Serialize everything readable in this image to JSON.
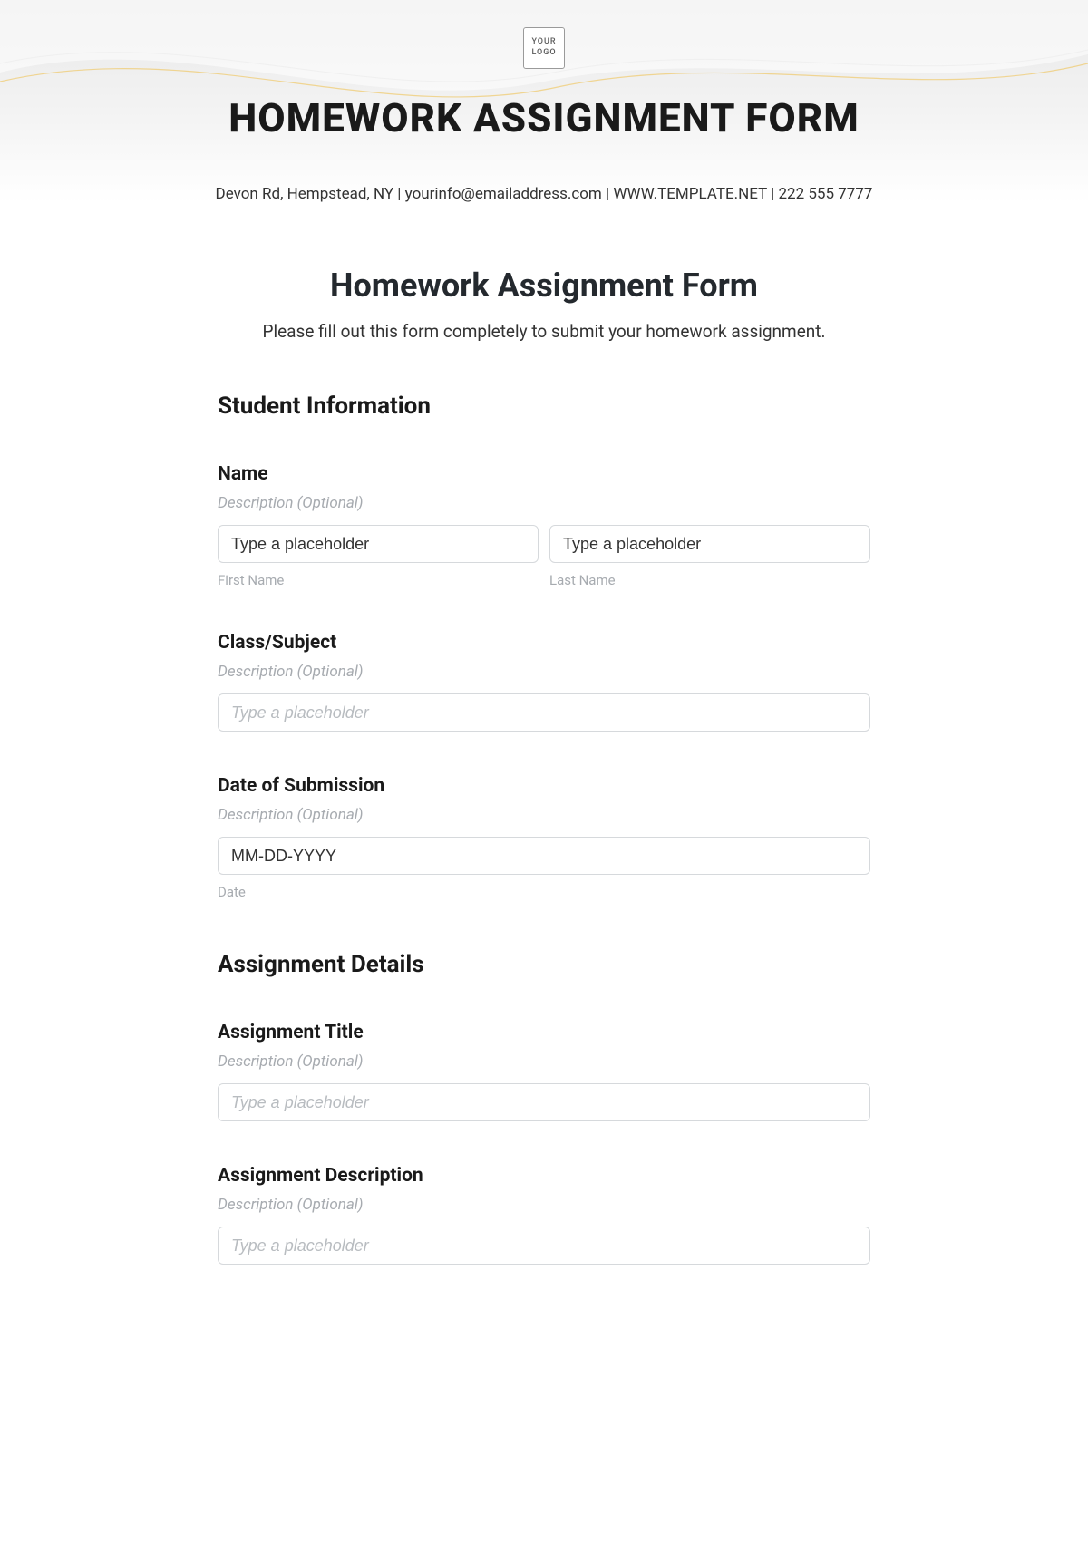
{
  "banner": {
    "logo_text": "YOUR LOGO",
    "title": "HOMEWORK ASSIGNMENT FORM",
    "contact": "Devon Rd, Hempstead, NY | yourinfo@emailaddress.com | WWW.TEMPLATE.NET | 222 555 7777"
  },
  "form": {
    "title": "Homework Assignment Form",
    "subtitle": "Please fill out this form completely to submit your homework assignment."
  },
  "sections": {
    "student_info": "Student Information",
    "assignment_details": "Assignment Details"
  },
  "fields": {
    "name": {
      "label": "Name",
      "desc": "Description (Optional)",
      "first_placeholder": "Type a placeholder",
      "first_sub": "First Name",
      "last_placeholder": "Type a placeholder",
      "last_sub": "Last Name"
    },
    "class_subject": {
      "label": "Class/Subject",
      "desc": "Description (Optional)",
      "placeholder": "Type a placeholder"
    },
    "date_submission": {
      "label": "Date of Submission",
      "desc": "Description (Optional)",
      "value": "MM-DD-YYYY",
      "sub": "Date"
    },
    "assignment_title": {
      "label": "Assignment Title",
      "desc": "Description (Optional)",
      "placeholder": "Type a placeholder"
    },
    "assignment_description": {
      "label": "Assignment Description",
      "desc": "Description (Optional)",
      "placeholder": "Type a placeholder"
    }
  }
}
